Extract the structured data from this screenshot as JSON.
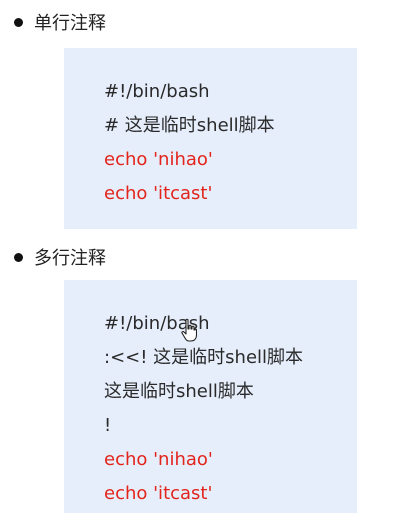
{
  "section1": {
    "heading": "单行注释",
    "lines": [
      {
        "text": "#!/bin/bash",
        "color": "#2a2a2a"
      },
      {
        "text": "# 这是临时shell脚本",
        "color": "#2a2a2a"
      },
      {
        "text": "echo 'nihao'",
        "color": "#e3241b"
      },
      {
        "text": "echo 'itcast'",
        "color": "#e3241b"
      }
    ]
  },
  "section2": {
    "heading": "多行注释",
    "lines": [
      {
        "text": "#!/bin/bash",
        "color": "#2a2a2a"
      },
      {
        "text": ":<<!  这是临时shell脚本",
        "color": "#2a2a2a"
      },
      {
        "text": "这是临时shell脚本",
        "color": "#2a2a2a"
      },
      {
        "text": "!",
        "color": "#2a2a2a"
      },
      {
        "text": "echo 'nihao'",
        "color": "#e3241b"
      },
      {
        "text": "echo 'itcast'",
        "color": "#e3241b"
      }
    ]
  },
  "colors": {
    "code_background": "#e6eefc",
    "comment_text": "#2a2a2a",
    "command_text": "#e3241b"
  },
  "icons": {
    "bullet": "bullet-dot-icon",
    "cursor": "mouse-pointer-icon"
  }
}
